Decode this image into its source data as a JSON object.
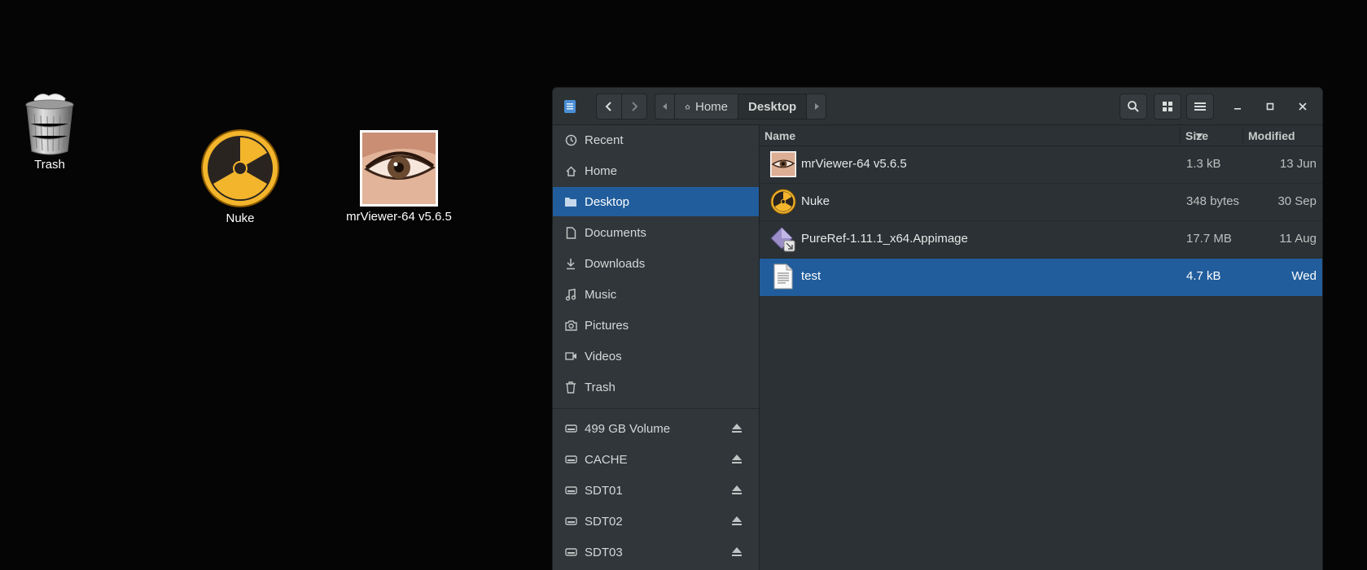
{
  "desktop": {
    "icons": [
      {
        "label": "Trash"
      },
      {
        "label": "Nuke"
      },
      {
        "label": "mrViewer-64 v5.6.5"
      }
    ]
  },
  "window": {
    "path": [
      "Home",
      "Desktop"
    ],
    "sidebar": {
      "places": [
        {
          "label": "Recent",
          "icon": "clock-icon"
        },
        {
          "label": "Home",
          "icon": "home-icon"
        },
        {
          "label": "Desktop",
          "icon": "folder-icon",
          "active": true
        },
        {
          "label": "Documents",
          "icon": "document-icon"
        },
        {
          "label": "Downloads",
          "icon": "download-icon"
        },
        {
          "label": "Music",
          "icon": "music-icon"
        },
        {
          "label": "Pictures",
          "icon": "camera-icon"
        },
        {
          "label": "Videos",
          "icon": "video-icon"
        },
        {
          "label": "Trash",
          "icon": "trash-icon"
        }
      ],
      "devices": [
        {
          "label": "499 GB Volume",
          "icon": "drive-icon"
        },
        {
          "label": "CACHE",
          "icon": "drive-icon"
        },
        {
          "label": "SDT01",
          "icon": "drive-icon"
        },
        {
          "label": "SDT02",
          "icon": "drive-icon"
        },
        {
          "label": "SDT03",
          "icon": "drive-icon"
        }
      ]
    },
    "columns": {
      "name": "Name",
      "size": "Size",
      "modified": "Modified"
    },
    "files": [
      {
        "name": "mrViewer-64 v5.6.5",
        "size": "1.3 kB",
        "modified": "13 Jun",
        "icon": "eye-image-icon"
      },
      {
        "name": "Nuke",
        "size": "348 bytes",
        "modified": "30 Sep",
        "icon": "nuke-icon"
      },
      {
        "name": "PureRef-1.11.1_x64.Appimage",
        "size": "17.7 MB",
        "modified": "11 Aug",
        "icon": "appimage-icon"
      },
      {
        "name": "test",
        "size": "4.7 kB",
        "modified": "Wed",
        "icon": "text-file-icon",
        "selected": true
      }
    ]
  },
  "colors": {
    "accent": "#215d9c",
    "background": "#050505"
  }
}
